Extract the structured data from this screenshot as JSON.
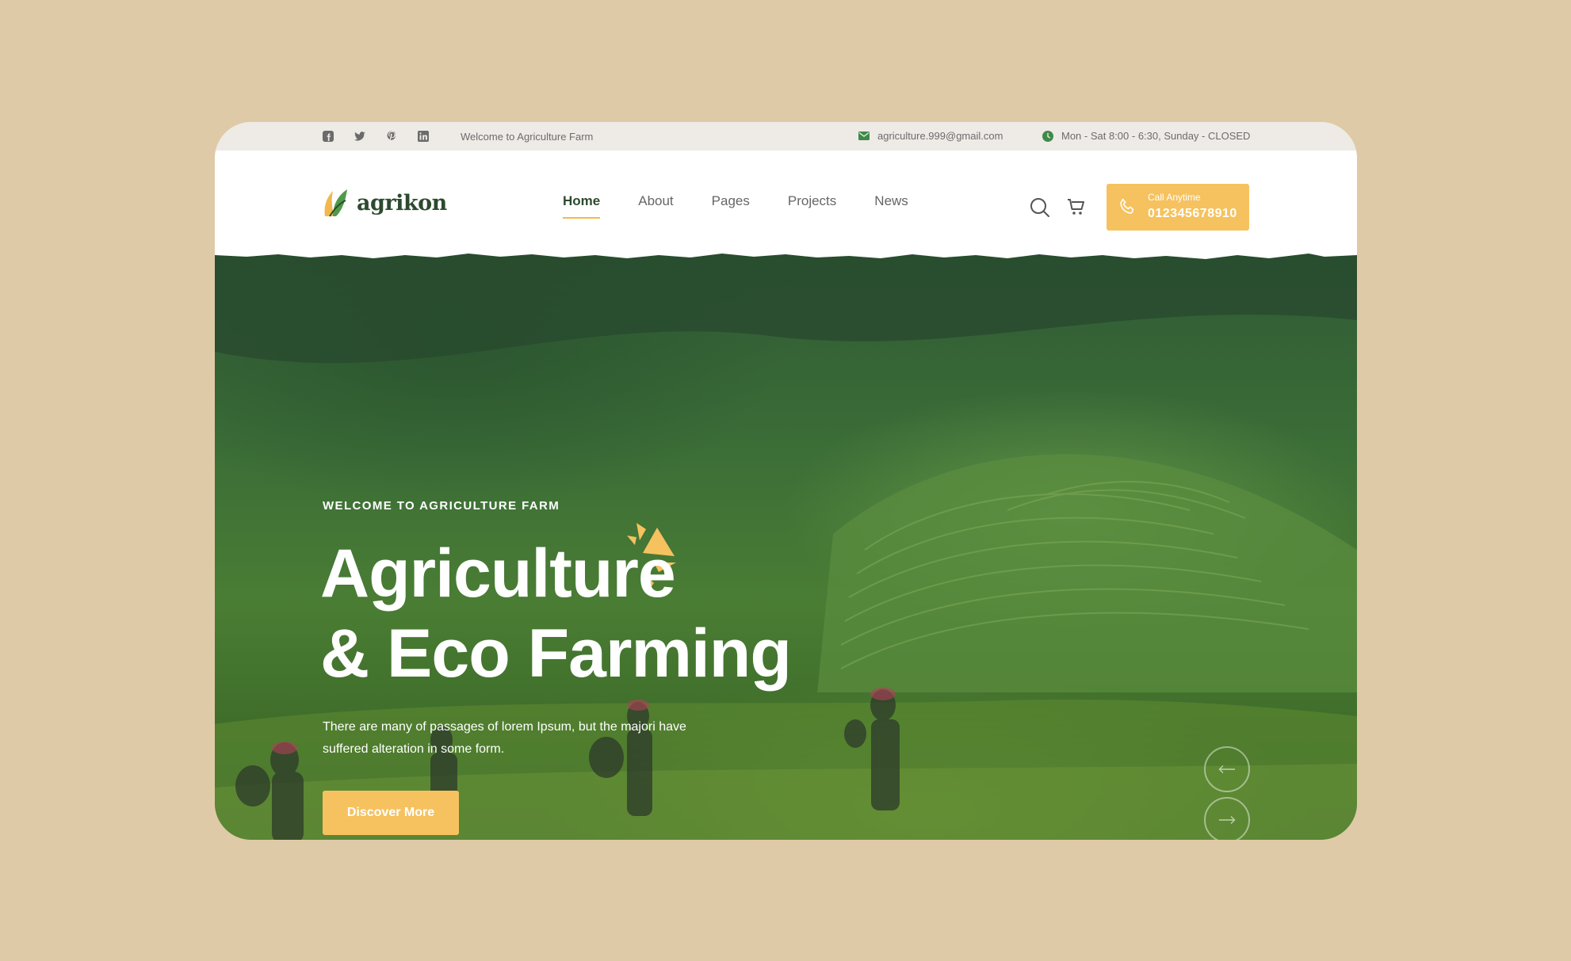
{
  "topbar": {
    "social_icons": [
      "facebook-icon",
      "twitter-icon",
      "pinterest-icon",
      "linkedin-icon"
    ],
    "welcome": "Welcome to Agriculture Farm",
    "email": "agriculture.999@gmail.com",
    "hours": "Mon - Sat 8:00 - 6:30, Sunday -  CLOSED"
  },
  "header": {
    "logo_text": "agrikon",
    "menu": [
      {
        "label": "Home",
        "active": true
      },
      {
        "label": "About",
        "active": false
      },
      {
        "label": "Pages",
        "active": false
      },
      {
        "label": "Projects",
        "active": false
      },
      {
        "label": "News",
        "active": false
      }
    ],
    "call": {
      "label": "Call Anytime",
      "number": "012345678910"
    }
  },
  "hero": {
    "tagline": "WELCOME TO AGRICULTURE FARM",
    "title_line1": "Agriculture",
    "title_line2": "& Eco Farming",
    "description": "There are many of passages of lorem Ipsum, but the majori have suffered alteration in some form.",
    "cta_label": "Discover More"
  },
  "colors": {
    "background": "#dfcaa8",
    "accent": "#f6c25f",
    "brand_green": "#2d4a2f",
    "topbar_bg": "#eeebe6"
  }
}
